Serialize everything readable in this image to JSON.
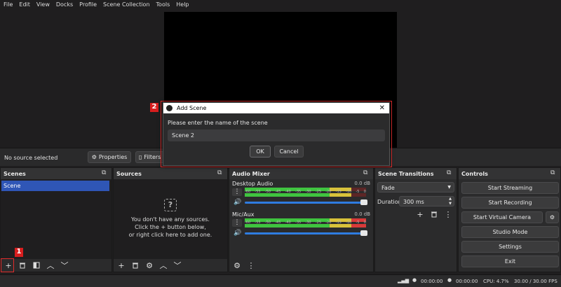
{
  "menu": [
    "File",
    "Edit",
    "View",
    "Docks",
    "Profile",
    "Scene Collection",
    "Tools",
    "Help"
  ],
  "source_bar": {
    "no_source": "No source selected",
    "properties": "Properties",
    "filters": "Filters"
  },
  "scenes": {
    "title": "Scenes",
    "items": [
      "Scene"
    ]
  },
  "sources": {
    "title": "Sources",
    "empty_line1": "You don't have any sources.",
    "empty_line2": "Click the + button below,",
    "empty_line3": "or right click here to add one."
  },
  "mixer": {
    "title": "Audio Mixer",
    "scale": [
      "-60",
      "-55",
      "-50",
      "-45",
      "-40",
      "-35",
      "-30",
      "-25",
      "-20",
      "-15",
      "-10",
      "-5",
      "0"
    ],
    "channels": [
      {
        "name": "Desktop Audio",
        "db": "0.0 dB",
        "level_fraction": 0.72
      },
      {
        "name": "Mic/Aux",
        "db": "0.0 dB",
        "level_fraction": 1.0
      }
    ]
  },
  "transitions": {
    "title": "Scene Transitions",
    "selected": "Fade",
    "duration_label": "Duration",
    "duration_value": "300 ms"
  },
  "controls": {
    "title": "Controls",
    "buttons": [
      "Start Streaming",
      "Start Recording",
      "Start Virtual Camera",
      "Studio Mode",
      "Settings",
      "Exit"
    ]
  },
  "status": {
    "time1": "00:00:00",
    "time2": "00:00:00",
    "cpu": "CPU: 4.7%",
    "fps": "30.00 / 30.00 FPS"
  },
  "dialog": {
    "title": "Add Scene",
    "prompt": "Please enter the name of the scene",
    "value": "Scene 2",
    "ok": "OK",
    "cancel": "Cancel"
  },
  "annotations": {
    "step1": "1",
    "step2": "2"
  },
  "colors": {
    "accent": "#2f56b6",
    "highlight": "#e02b2b",
    "meter_green": "#3fc43f",
    "meter_yellow": "#d8c23a",
    "meter_red": "#d83a3a"
  }
}
